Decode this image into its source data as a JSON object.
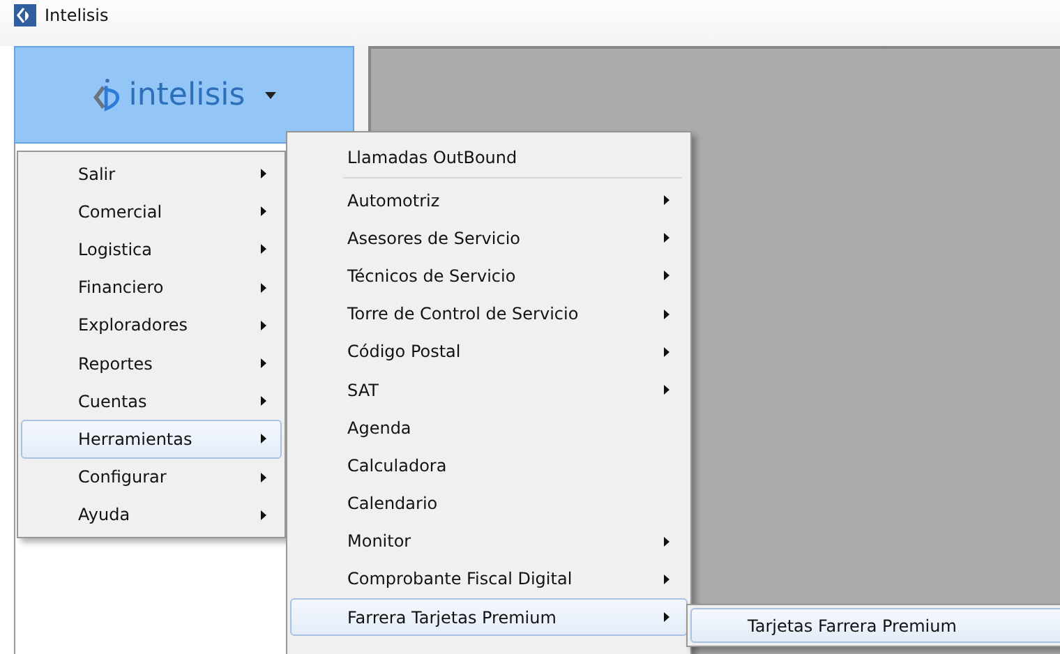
{
  "window": {
    "title": "Intelisis"
  },
  "app_button": {
    "logo_text": "intelisis"
  },
  "main_menu": [
    {
      "label": "Salir",
      "has_submenu": true,
      "selected": false
    },
    {
      "label": "Comercial",
      "has_submenu": true,
      "selected": false
    },
    {
      "label": "Logistica",
      "has_submenu": true,
      "selected": false
    },
    {
      "label": "Financiero",
      "has_submenu": true,
      "selected": false
    },
    {
      "label": "Exploradores",
      "has_submenu": true,
      "selected": false
    },
    {
      "label": "Reportes",
      "has_submenu": true,
      "selected": false
    },
    {
      "label": "Cuentas",
      "has_submenu": true,
      "selected": false
    },
    {
      "label": "Herramientas",
      "has_submenu": true,
      "selected": true
    },
    {
      "label": "Configurar",
      "has_submenu": true,
      "selected": false
    },
    {
      "label": "Ayuda",
      "has_submenu": true,
      "selected": false
    }
  ],
  "submenu": {
    "header_item": "Llamadas OutBound",
    "items": [
      {
        "label": "Automotriz",
        "has_submenu": true,
        "selected": false
      },
      {
        "label": "Asesores de Servicio",
        "has_submenu": true,
        "selected": false
      },
      {
        "label": "Técnicos de Servicio",
        "has_submenu": true,
        "selected": false
      },
      {
        "label": "Torre de Control de Servicio",
        "has_submenu": true,
        "selected": false
      },
      {
        "label": "Código Postal",
        "has_submenu": true,
        "selected": false
      },
      {
        "label": "SAT",
        "has_submenu": true,
        "selected": false
      },
      {
        "label": "Agenda",
        "has_submenu": false,
        "selected": false
      },
      {
        "label": "Calculadora",
        "has_submenu": false,
        "selected": false
      },
      {
        "label": "Calendario",
        "has_submenu": false,
        "selected": false
      },
      {
        "label": "Monitor",
        "has_submenu": true,
        "selected": false
      },
      {
        "label": "Comprobante Fiscal Digital",
        "has_submenu": true,
        "selected": false
      },
      {
        "label": "Farrera Tarjetas Premium",
        "has_submenu": true,
        "selected": true
      }
    ]
  },
  "flyout": [
    {
      "label": "Tarjetas Farrera Premium",
      "selected": true
    }
  ]
}
